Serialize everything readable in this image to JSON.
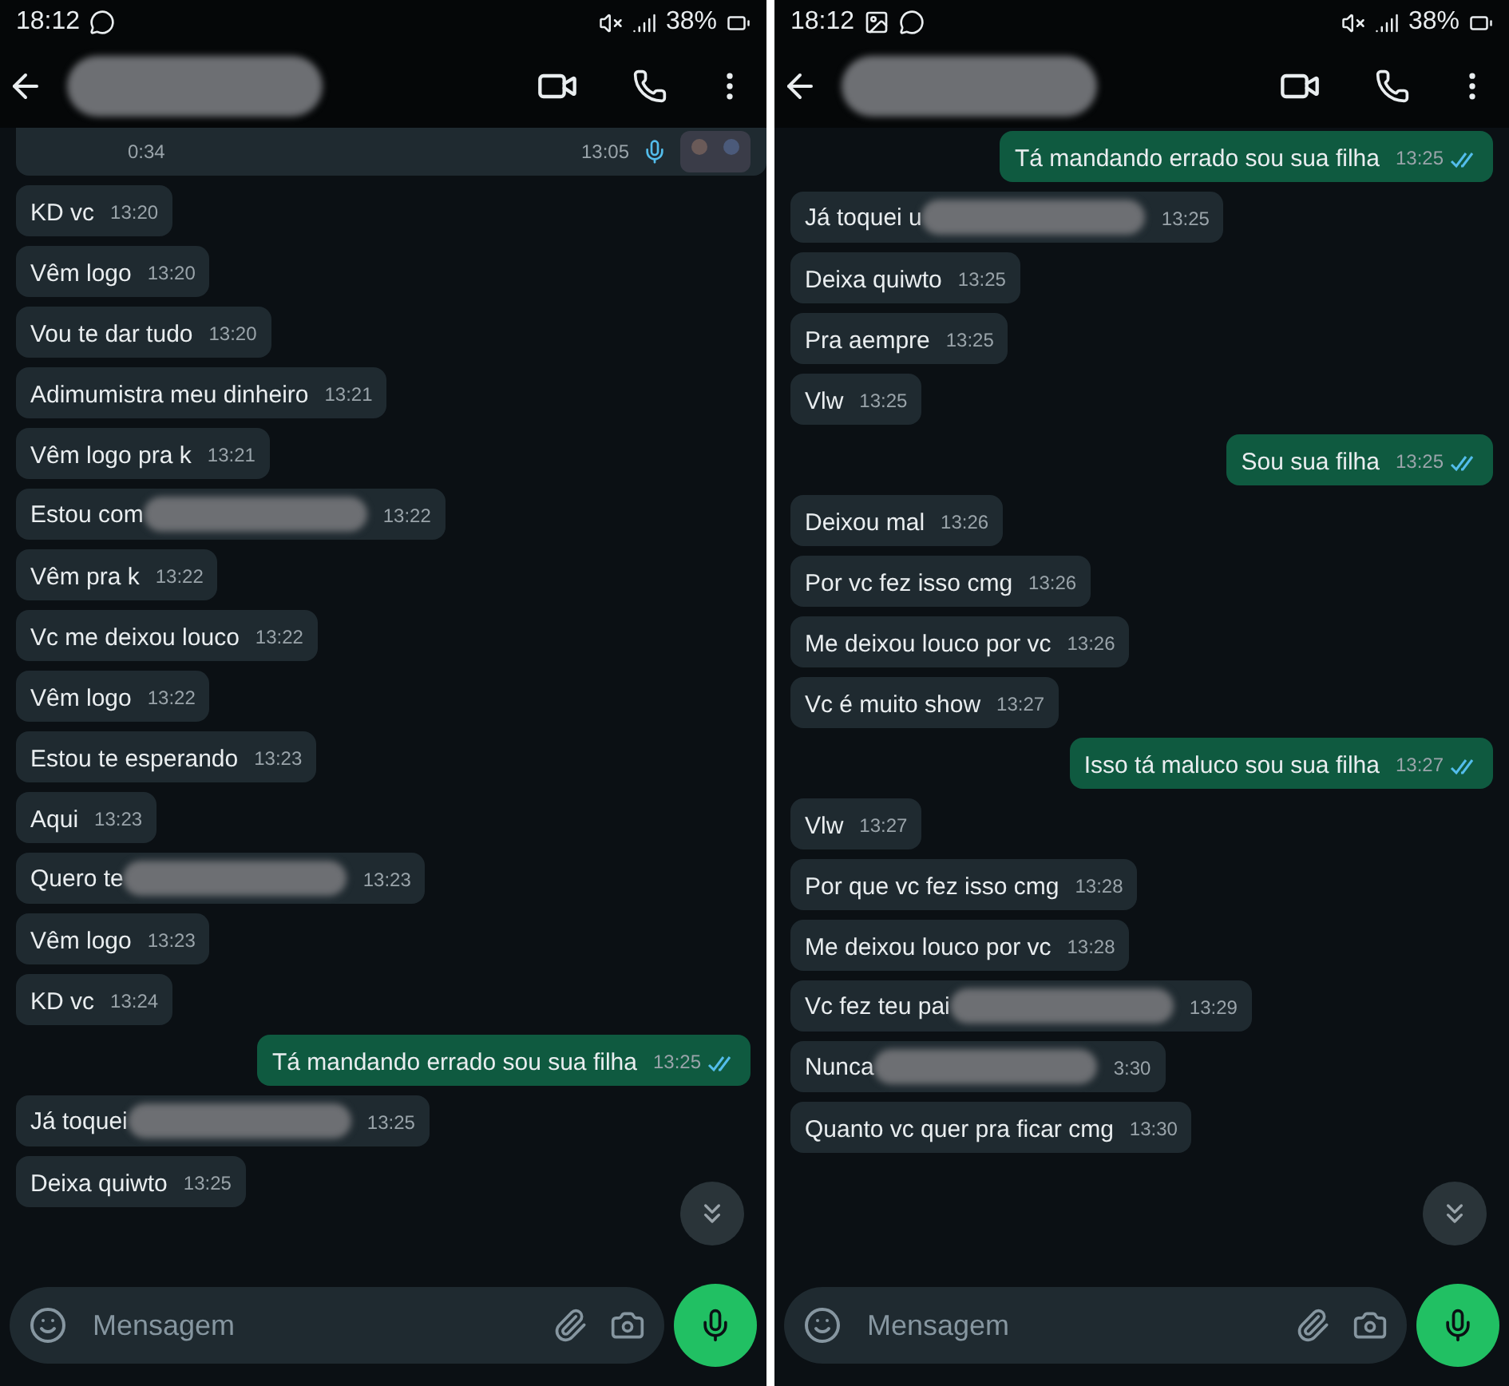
{
  "panels": [
    {
      "status": {
        "time": "18:12",
        "notifications": [
          {
            "kind": "whatsapp"
          }
        ],
        "battery": "38%"
      },
      "messages": [
        {
          "kind": "audio",
          "duration": "0:34",
          "time": "13:05"
        },
        {
          "kind": "in",
          "text": "KD vc",
          "time": "13:20",
          "redacted": false
        },
        {
          "kind": "in",
          "text": "Vêm logo",
          "time": "13:20",
          "redacted": false
        },
        {
          "kind": "in",
          "text": "Vou te dar tudo",
          "time": "13:20",
          "redacted": false
        },
        {
          "kind": "in",
          "text": "Adimumistra meu dinheiro",
          "time": "13:21",
          "redacted": false
        },
        {
          "kind": "in",
          "text": "Vêm logo pra k",
          "time": "13:21",
          "redacted": false
        },
        {
          "kind": "in",
          "text": "Estou com",
          "time": "13:22",
          "redacted": true
        },
        {
          "kind": "in",
          "text": "Vêm pra k",
          "time": "13:22",
          "redacted": false
        },
        {
          "kind": "in",
          "text": "Vc me deixou louco",
          "time": "13:22",
          "redacted": false
        },
        {
          "kind": "in",
          "text": "Vêm logo",
          "time": "13:22",
          "redacted": false
        },
        {
          "kind": "in",
          "text": "Estou te esperando",
          "time": "13:23",
          "redacted": false
        },
        {
          "kind": "in",
          "text": "Aqui",
          "time": "13:23",
          "redacted": false
        },
        {
          "kind": "in",
          "text": "Quero te",
          "time": "13:23",
          "redacted": true
        },
        {
          "kind": "in",
          "text": "Vêm logo",
          "time": "13:23",
          "redacted": false
        },
        {
          "kind": "in",
          "text": "KD vc",
          "time": "13:24",
          "redacted": false
        },
        {
          "kind": "out",
          "text": "Tá mandando errado sou sua filha",
          "time": "13:25",
          "read": true
        },
        {
          "kind": "in",
          "text": "Já toquei",
          "time": "13:25",
          "redacted": true
        },
        {
          "kind": "in",
          "text": "Deixa quiwto",
          "time": "13:25",
          "redacted": false
        }
      ],
      "input": {
        "placeholder": "Mensagem"
      }
    },
    {
      "status": {
        "time": "18:12",
        "notifications": [
          {
            "kind": "gallery"
          },
          {
            "kind": "whatsapp"
          }
        ],
        "battery": "38%"
      },
      "messages": [
        {
          "kind": "out",
          "text": "Tá mandando errado sou sua filha",
          "time": "13:25",
          "read": true
        },
        {
          "kind": "in",
          "text": "Já toquei u",
          "time": "13:25",
          "redacted": true
        },
        {
          "kind": "in",
          "text": "Deixa quiwto",
          "time": "13:25",
          "redacted": false
        },
        {
          "kind": "in",
          "text": "Pra aempre",
          "time": "13:25",
          "redacted": false
        },
        {
          "kind": "in",
          "text": "Vlw",
          "time": "13:25",
          "redacted": false
        },
        {
          "kind": "out",
          "text": "Sou sua filha",
          "time": "13:25",
          "read": true
        },
        {
          "kind": "in",
          "text": "Deixou mal",
          "time": "13:26",
          "redacted": false
        },
        {
          "kind": "in",
          "text": "Por vc fez isso cmg",
          "time": "13:26",
          "redacted": false
        },
        {
          "kind": "in",
          "text": "Me deixou louco por vc",
          "time": "13:26",
          "redacted": false
        },
        {
          "kind": "in",
          "text": "Vc é muito show",
          "time": "13:27",
          "redacted": false
        },
        {
          "kind": "out",
          "text": "Isso tá maluco sou sua filha",
          "time": "13:27",
          "read": true
        },
        {
          "kind": "in",
          "text": "Vlw",
          "time": "13:27",
          "redacted": false
        },
        {
          "kind": "in",
          "text": "Por que vc fez isso cmg",
          "time": "13:28",
          "redacted": false
        },
        {
          "kind": "in",
          "text": "Me deixou louco por vc",
          "time": "13:28",
          "redacted": false
        },
        {
          "kind": "in",
          "text": "Vc fez teu pai",
          "time": "13:29",
          "redacted": true
        },
        {
          "kind": "in",
          "text": "Nunca",
          "time": "3:30",
          "redacted": true
        },
        {
          "kind": "in",
          "text": "Quanto vc quer pra ficar cmg",
          "time": "13:30",
          "redacted": false
        }
      ],
      "input": {
        "placeholder": "Mensagem"
      }
    }
  ]
}
